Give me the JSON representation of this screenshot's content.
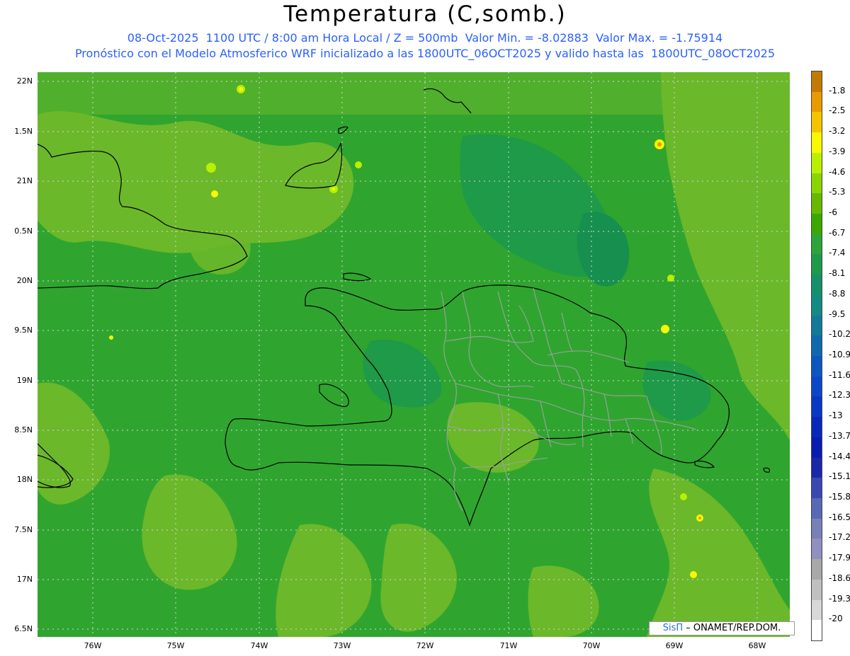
{
  "title": "Temperatura (C,somb.)",
  "subtitle1": "08-Oct-2025  1100 UTC / 8:00 am Hora Local / Z = 500mb  Valor Min. = -8.02883  Valor Max. = -1.75914",
  "subtitle2": "Pronóstico con el Modelo Atmosferico WRF inicializado a las 1800UTC_06OCT2025 y valido hasta las  1800UTC_08OCT2025",
  "credit": {
    "logo": "SisΠ",
    "text": " – ONAMET/REP.DOM."
  },
  "axes": {
    "y_ticks": [
      "22N",
      "1.5N",
      "21N",
      "0.5N",
      "20N",
      "9.5N",
      "19N",
      "8.5N",
      "18N",
      "7.5N",
      "17N",
      "6.5N"
    ],
    "x_ticks": [
      "76W",
      "75W",
      "74W",
      "73W",
      "72W",
      "71W",
      "70W",
      "69W",
      "68W"
    ],
    "grid": "dotted"
  },
  "colorbar": {
    "labels": [
      "-1.8",
      "-2.5",
      "-3.2",
      "-3.9",
      "-4.6",
      "-5.3",
      "-6",
      "-6.7",
      "-7.4",
      "-8.1",
      "-8.8",
      "-9.5",
      "-10.2",
      "-10.9",
      "-11.6",
      "-12.3",
      "-13",
      "-13.7",
      "-14.4",
      "-15.1",
      "-15.8",
      "-16.5",
      "-17.2",
      "-17.9",
      "-18.6",
      "-19.3",
      "-20"
    ],
    "colors": [
      "#c47a00",
      "#e89a00",
      "#f5c400",
      "#f8f800",
      "#b8f000",
      "#8cd400",
      "#66b800",
      "#3aa800",
      "#2da43a",
      "#1c9a4a",
      "#15906a",
      "#138a84",
      "#127a98",
      "#1068b0",
      "#0c58c0",
      "#0a48c8",
      "#0838c4",
      "#0828bc",
      "#0a1cb0",
      "#1a28a8",
      "#3a48b0",
      "#5868b4",
      "#7880b8",
      "#9090c0",
      "#a8a8a8",
      "#c0c0c0",
      "#d8d8d8",
      "#ffffff"
    ]
  },
  "colors": {
    "sea_green": "#2fa52f",
    "light_green": "#6bb82a",
    "dark_green": "#1e9a48",
    "border_gray": "#a0a0a0",
    "subtitle_blue": "#2a60ff"
  }
}
